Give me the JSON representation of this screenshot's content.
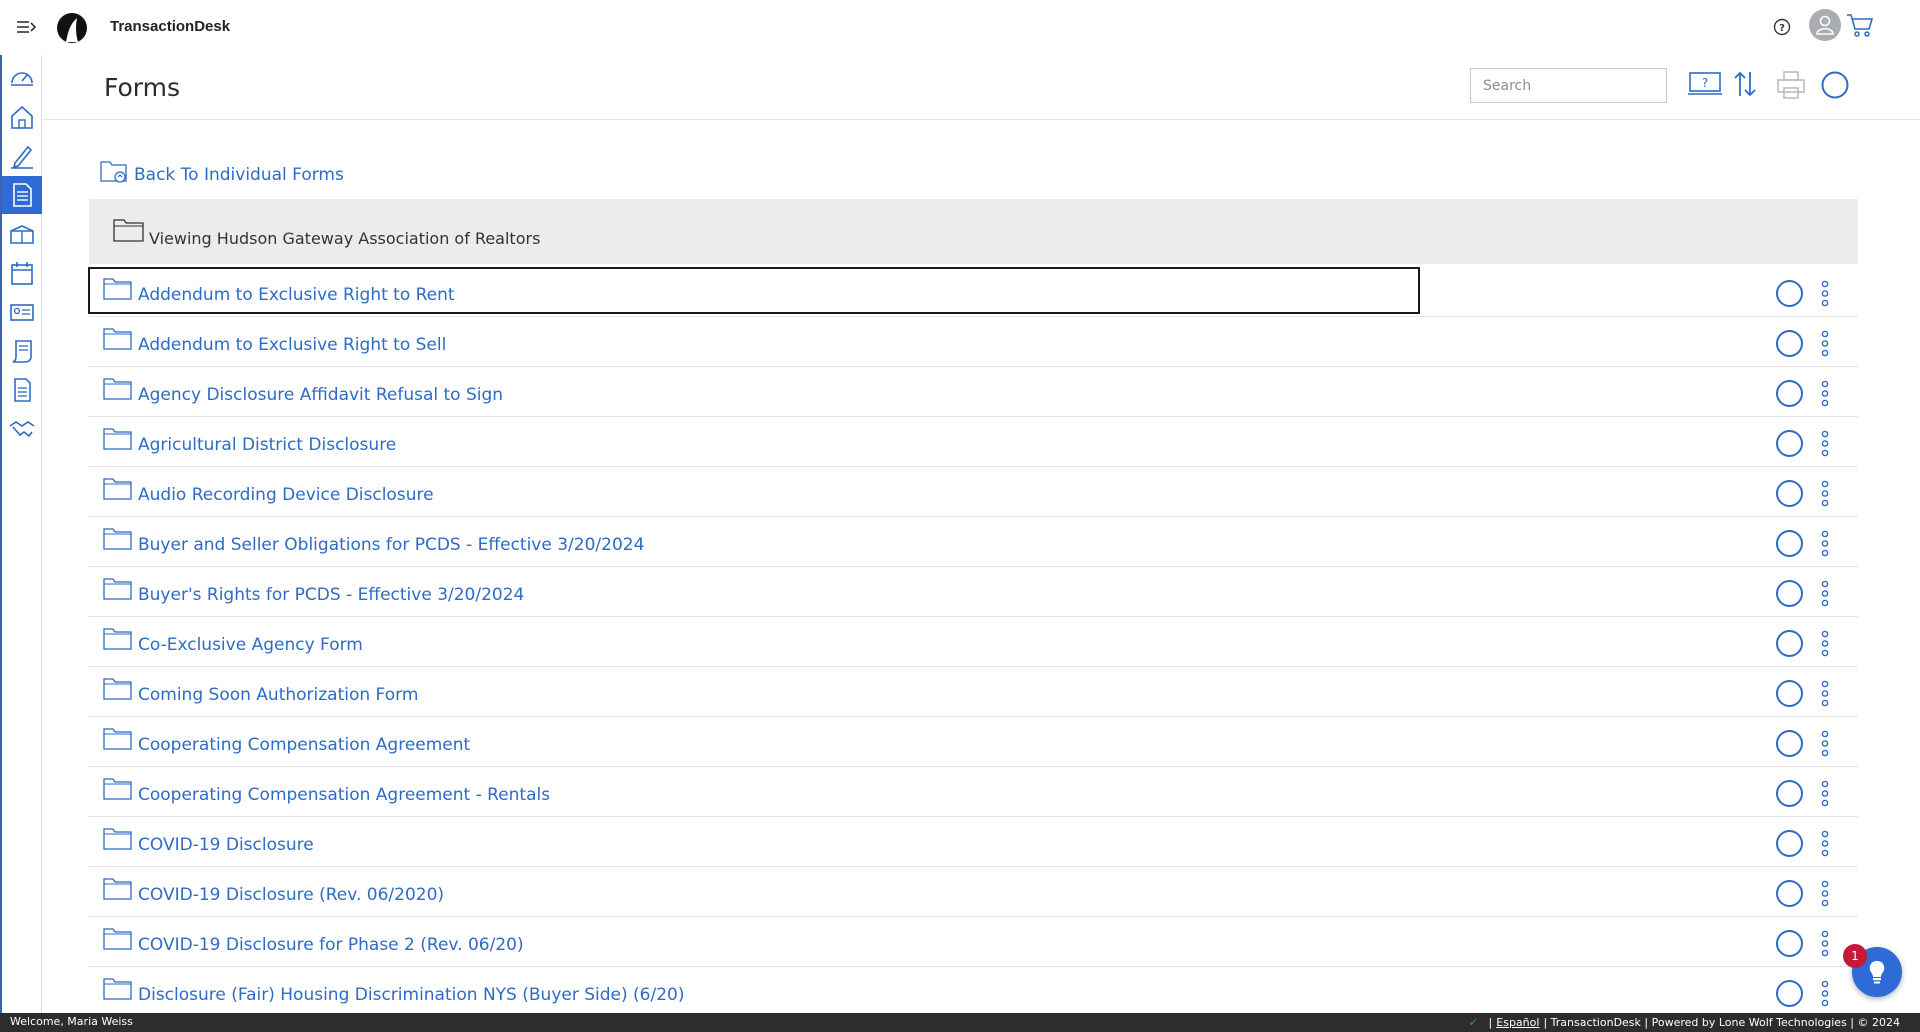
{
  "app": {
    "title": "TransactionDesk"
  },
  "page": {
    "title": "Forms"
  },
  "search": {
    "placeholder": "Search"
  },
  "sidebar": {
    "items": [
      {
        "name": "dashboard-icon"
      },
      {
        "name": "home-icon"
      },
      {
        "name": "pen-icon"
      },
      {
        "name": "forms-document-icon",
        "active": true
      },
      {
        "name": "listings-box-icon"
      },
      {
        "name": "calendar-icon"
      },
      {
        "name": "contacts-card-icon"
      },
      {
        "name": "scroll-icon"
      },
      {
        "name": "file-text-icon"
      },
      {
        "name": "handshake-icon"
      }
    ]
  },
  "back_link": {
    "label": "Back To Individual Forms"
  },
  "viewing": {
    "label": "Viewing Hudson Gateway Association of Realtors"
  },
  "forms": [
    "Addendum to Exclusive Right to Rent",
    "Addendum to Exclusive Right to Sell",
    "Agency Disclosure Affidavit Refusal to Sign",
    "Agricultural District Disclosure",
    "Audio Recording Device Disclosure",
    "Buyer and Seller Obligations for PCDS - Effective 3/20/2024",
    "Buyer's Rights for PCDS - Effective 3/20/2024",
    "Co-Exclusive Agency Form",
    "Coming Soon Authorization Form",
    "Cooperating Compensation Agreement",
    "Cooperating Compensation Agreement - Rentals",
    "COVID-19 Disclosure",
    "COVID-19 Disclosure (Rev. 06/2020)",
    "COVID-19 Disclosure for Phase 2 (Rev. 06/20)",
    "Disclosure (Fair) Housing Discrimination NYS (Buyer Side) (6/20)"
  ],
  "footer": {
    "welcome": "Welcome, Maria Weiss",
    "espanol": "Español",
    "suffix": "| TransactionDesk | Powered by Lone Wolf Technologies | © 2024"
  },
  "hint": {
    "badge_count": "1"
  },
  "colors": {
    "accent": "#2e6bd6",
    "link": "#2e6bc4",
    "badge": "#c8183a"
  }
}
